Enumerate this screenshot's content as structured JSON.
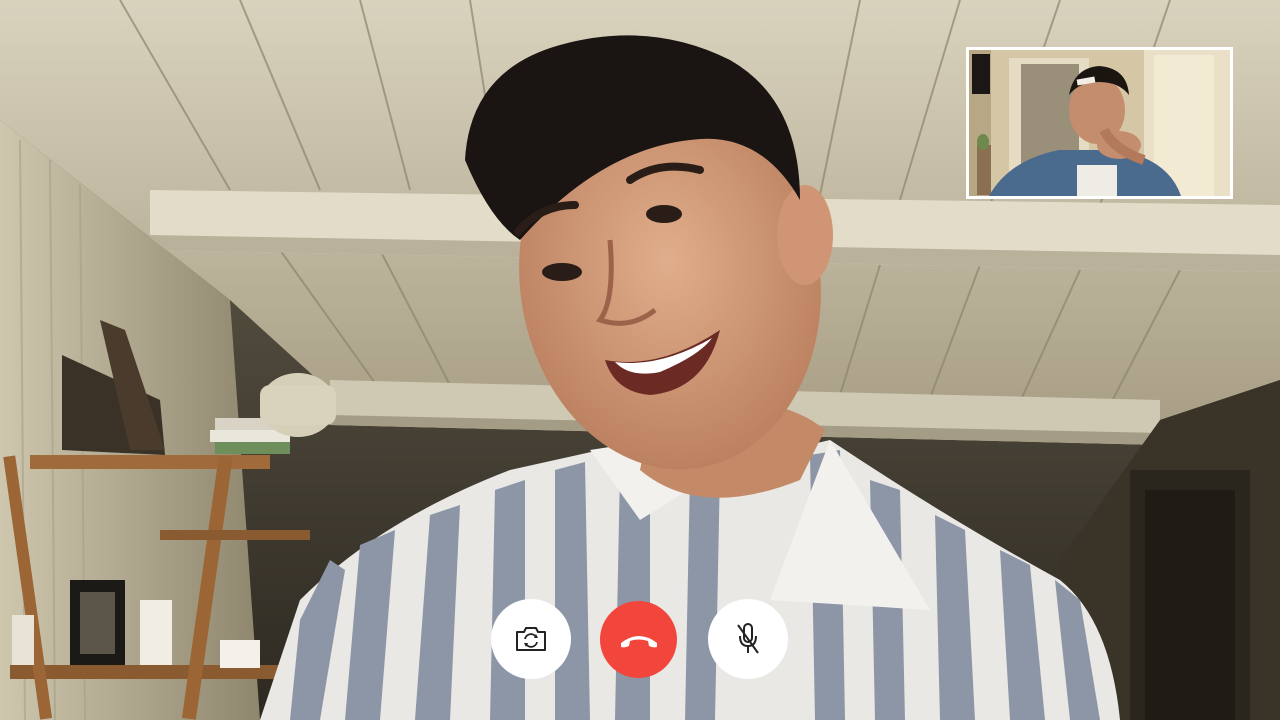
{
  "call": {
    "remote_feed": "remote-participant-video",
    "self_view": "local-camera-preview"
  },
  "controls": {
    "flip_camera": {
      "icon": "camera-flip-icon"
    },
    "end_call": {
      "icon": "phone-hangup-icon",
      "color": "#f2463d"
    },
    "mute": {
      "icon": "microphone-mute-icon"
    }
  },
  "colors": {
    "control_bg": "#ffffff",
    "end_call_bg": "#f2463d",
    "self_view_border": "#ffffff"
  }
}
